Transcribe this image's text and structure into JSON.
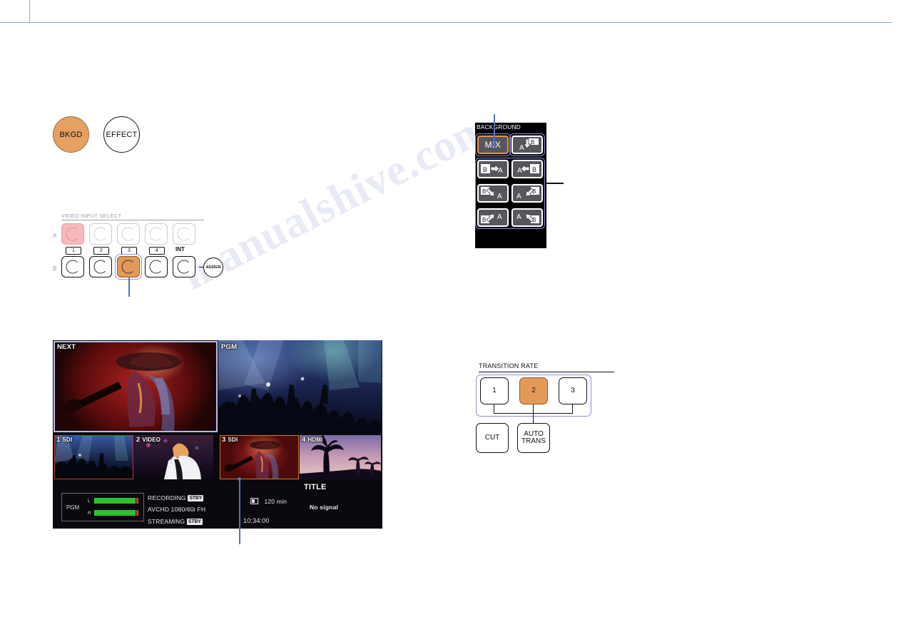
{
  "watermark": {
    "text": "manualshive.com"
  },
  "header": {
    "rule": true
  },
  "mode_buttons": [
    {
      "name": "bkgd",
      "label": "BKGD",
      "state": "on"
    },
    {
      "name": "effect",
      "label": "EFFECT",
      "state": "off"
    }
  ],
  "video_input_select": {
    "caption": "VIDEO INPUT SELECT",
    "row_a_label": "A",
    "row_b_label": "B",
    "number_labels": [
      "1",
      "2",
      "3",
      "4"
    ],
    "int_label": "INT",
    "assign_label": "ASSIGN",
    "row_a": [
      {
        "index": 1,
        "state": "pink"
      },
      {
        "index": 2,
        "state": "dim"
      },
      {
        "index": 3,
        "state": "dim"
      },
      {
        "index": 4,
        "state": "dim"
      },
      {
        "index": 5,
        "state": "dim"
      }
    ],
    "row_b": [
      {
        "index": 1,
        "state": "off"
      },
      {
        "index": 2,
        "state": "off"
      },
      {
        "index": 3,
        "state": "orange-selected"
      },
      {
        "index": 4,
        "state": "off"
      },
      {
        "index": 5,
        "state": "off"
      }
    ]
  },
  "background_panel": {
    "title": "BACKGROUND",
    "patterns": [
      {
        "id": "mix",
        "label": "MIX",
        "state": "selected",
        "kind": "text"
      },
      {
        "id": "wipe-a-down-b",
        "label": "A▼B",
        "state": "normal",
        "kind": "wipe",
        "from": "A",
        "to": "B",
        "dir": "down"
      },
      {
        "id": "wipe-b-right-a",
        "label": "B▶A",
        "state": "normal",
        "kind": "wipe",
        "from": "B",
        "to": "A",
        "dir": "right"
      },
      {
        "id": "wipe-a-left-b",
        "label": "A◀B",
        "state": "normal",
        "kind": "wipe",
        "from": "A",
        "to": "B",
        "dir": "left"
      },
      {
        "id": "wipe-b-diag-a",
        "label": "B↘A",
        "state": "normal",
        "kind": "wipe",
        "from": "B",
        "to": "A",
        "dir": "down-right"
      },
      {
        "id": "wipe-a-diag-b",
        "label": "A↗B",
        "state": "normal",
        "kind": "wipe",
        "from": "A",
        "to": "B",
        "dir": "up-right"
      },
      {
        "id": "wipe-b-up-a",
        "label": "B↗A",
        "state": "normal",
        "kind": "wipe",
        "from": "B",
        "to": "A",
        "dir": "up-right"
      },
      {
        "id": "wipe-a-down-left-b",
        "label": "A↙B",
        "state": "normal",
        "kind": "wipe",
        "from": "A",
        "to": "B",
        "dir": "down-left"
      }
    ]
  },
  "transition_rate": {
    "caption": "TRANSITION RATE",
    "rates": [
      {
        "label": "1",
        "state": "off"
      },
      {
        "label": "2",
        "state": "on"
      },
      {
        "label": "3",
        "state": "off"
      }
    ],
    "cut_label": "CUT",
    "auto_trans_label_line1": "AUTO",
    "auto_trans_label_line2": "TRANS"
  },
  "multiviewer": {
    "next_label": "NEXT",
    "pgm_label": "PGM",
    "title_overlay": "TITLE",
    "thumbnails": [
      {
        "num": "1",
        "src": "SDI",
        "state": "red-border"
      },
      {
        "num": "2",
        "src": "VIDEO",
        "state": "plain"
      },
      {
        "num": "3",
        "src": "SDI",
        "state": "orange-border"
      },
      {
        "num": "4",
        "src": "HDMI",
        "state": "plain"
      }
    ],
    "status": {
      "meter_label": "PGM",
      "meter_ch_l": "L",
      "meter_ch_r": "R",
      "recording_label": "RECORDING",
      "recording_badge": "STBY",
      "format": "AVCHD  1080/60i FH",
      "streaming_label": "STREAMING",
      "streaming_badge": "STBY",
      "battery": "120 min",
      "no_signal": "No signal",
      "clock": "10:34:00"
    }
  },
  "colors": {
    "accent_orange": "#e49a57",
    "select_ring": "#8b8fd6",
    "pink": "#f7b9bd",
    "rule": "#8fa9c4",
    "meter_green": "#2ec12e"
  }
}
